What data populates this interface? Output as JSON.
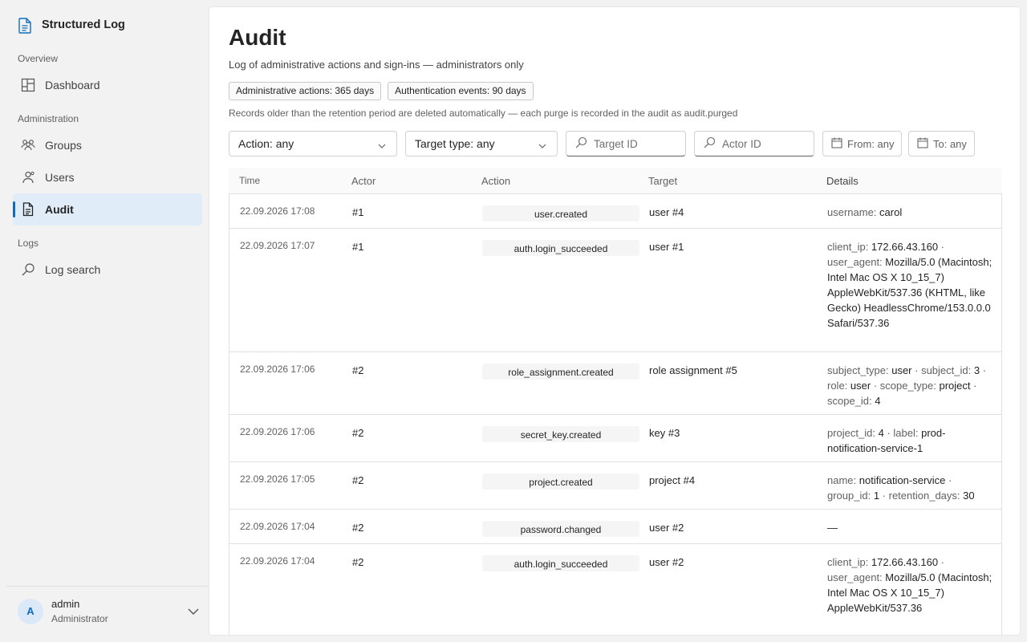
{
  "app": {
    "name": "Structured Log"
  },
  "nav": {
    "sections": [
      {
        "label": "Overview"
      },
      {
        "label": "Administration"
      },
      {
        "label": "Logs"
      }
    ],
    "items": [
      {
        "label": "Dashboard",
        "icon": "dashboard-icon"
      },
      {
        "label": "Groups",
        "icon": "groups-icon"
      },
      {
        "label": "Users",
        "icon": "user-icon"
      },
      {
        "label": "Audit",
        "icon": "document-icon",
        "active": true
      },
      {
        "label": "Log search",
        "icon": "search-icon"
      }
    ]
  },
  "user": {
    "initial": "A",
    "name": "admin",
    "role": "Administrator"
  },
  "page": {
    "title": "Audit",
    "subtitle": "Log of administrative actions and sign-ins — administrators only",
    "badges": [
      "Administrative actions: 365 days",
      "Authentication events: 90 days"
    ],
    "note": "Records older than the retention period are deleted automatically — each purge is recorded in the audit as audit.purged"
  },
  "filters": {
    "action": "Action: any",
    "target_type": "Target type: any",
    "target_id_placeholder": "Target ID",
    "actor_id_placeholder": "Actor ID",
    "from": "From: any",
    "to": "To: any"
  },
  "table": {
    "columns": [
      "Time",
      "Actor",
      "Action",
      "Target",
      "Details"
    ],
    "rows": [
      {
        "time": "22.09.2026 17:08",
        "actor": "#1",
        "action": "user.created",
        "target": "user #4",
        "details": [
          [
            "username: ",
            "carol",
            ""
          ]
        ]
      },
      {
        "time": "22.09.2026 17:07",
        "actor": "#1",
        "action": "auth.login_succeeded",
        "target": "user #1",
        "details": [
          [
            "client_ip: ",
            "172.66.43.160",
            " · "
          ],
          [
            "user_agent: ",
            "Mozilla/5.0 (Macintosh; Intel Mac OS X 10_15_7) AppleWebKit/537.36 (KHTML, like Gecko) HeadlessChrome/153.0.0.0 Safari/537.36",
            ""
          ]
        ]
      },
      {
        "time": "22.09.2026 17:06",
        "actor": "#2",
        "action": "role_assignment.created",
        "target": "role assignment #5",
        "details": [
          [
            "subject_type: ",
            "user",
            " · "
          ],
          [
            "subject_id: ",
            "3",
            " · "
          ],
          [
            "role: ",
            "user",
            " · "
          ],
          [
            "scope_type: ",
            "project",
            " · "
          ],
          [
            "scope_id: ",
            "4",
            ""
          ]
        ]
      },
      {
        "time": "22.09.2026 17:06",
        "actor": "#2",
        "action": "secret_key.created",
        "target": "key #3",
        "details": [
          [
            "project_id: ",
            "4",
            " · "
          ],
          [
            "label: ",
            "prod-notification-service-1",
            ""
          ]
        ]
      },
      {
        "time": "22.09.2026 17:05",
        "actor": "#2",
        "action": "project.created",
        "target": "project #4",
        "details": [
          [
            "name: ",
            "notification-service",
            " · "
          ],
          [
            "group_id: ",
            "1",
            " · "
          ],
          [
            "retention_days: ",
            "30",
            ""
          ]
        ]
      },
      {
        "time": "22.09.2026 17:04",
        "actor": "#2",
        "action": "password.changed",
        "target": "user #2",
        "details": [
          [
            "",
            "—",
            ""
          ]
        ]
      },
      {
        "time": "22.09.2026 17:04",
        "actor": "#2",
        "action": "auth.login_succeeded",
        "target": "user #2",
        "details": [
          [
            "client_ip: ",
            "172.66.43.160",
            " · "
          ],
          [
            "user_agent: ",
            "Mozilla/5.0 (Macintosh; Intel Mac OS X 10_15_7) AppleWebKit/537.36",
            ""
          ]
        ]
      }
    ]
  }
}
